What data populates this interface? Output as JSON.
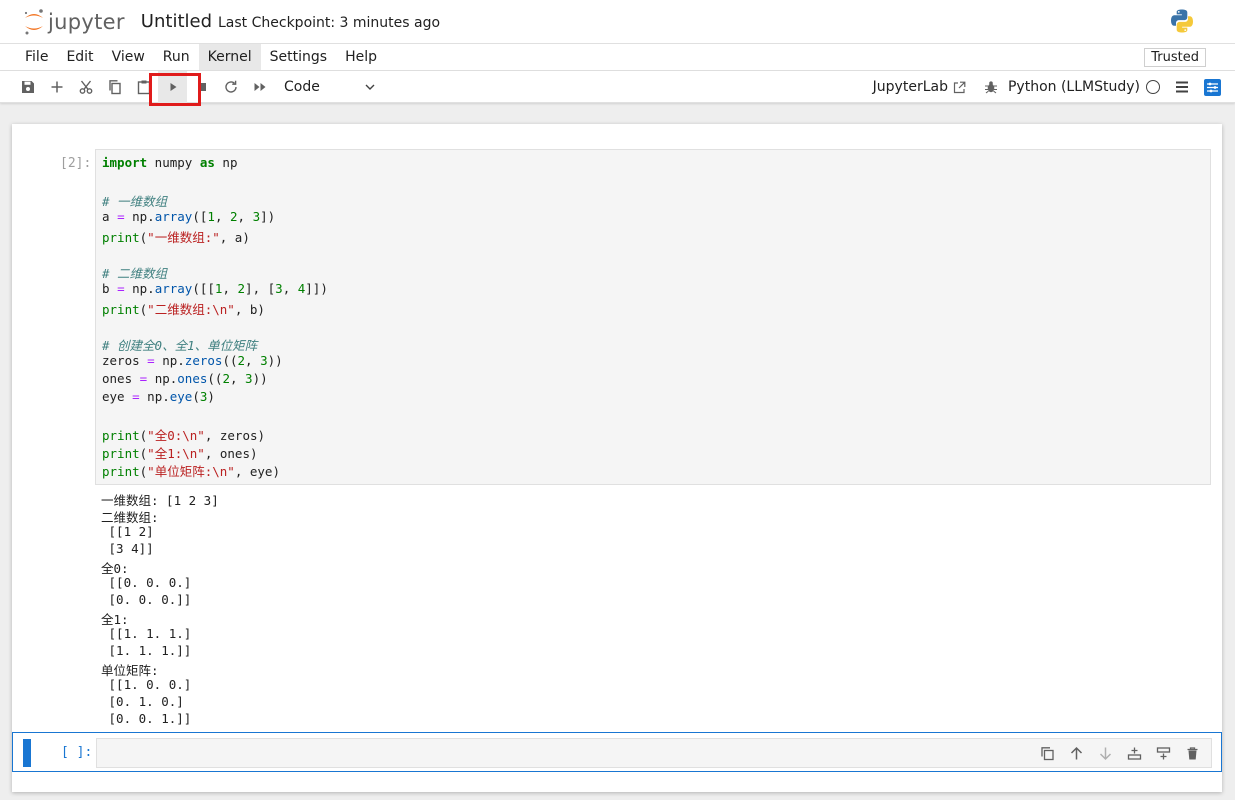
{
  "header": {
    "logo_text": "jupyter",
    "notebook_title": "Untitled",
    "checkpoint": "Last Checkpoint: 3 minutes ago"
  },
  "menu": {
    "items": [
      "File",
      "Edit",
      "View",
      "Run",
      "Kernel",
      "Settings",
      "Help"
    ],
    "active": "Kernel",
    "trusted": "Trusted"
  },
  "toolbar": {
    "cell_type": "Code",
    "jupyterlab_label": "JupyterLab",
    "kernel_name": "Python (LLMStudy)"
  },
  "cells": [
    {
      "prompt": "[2]:",
      "code": [
        "import numpy as np",
        "",
        "# 一维数组",
        "a = np.array([1, 2, 3])",
        "print(\"一维数组:\", a)",
        "",
        "# 二维数组",
        "b = np.array([[1, 2], [3, 4]])",
        "print(\"二维数组:\\n\", b)",
        "",
        "# 创建全0、全1、单位矩阵",
        "zeros = np.zeros((2, 3))",
        "ones = np.ones((2, 3))",
        "eye = np.eye(3)",
        "",
        "print(\"全0:\\n\", zeros)",
        "print(\"全1:\\n\", ones)",
        "print(\"单位矩阵:\\n\", eye)"
      ],
      "output": [
        "一维数组: [1 2 3]",
        "二维数组:",
        " [[1 2]",
        " [3 4]]",
        "全0:",
        " [[0. 0. 0.]",
        " [0. 0. 0.]]",
        "全1:",
        " [[1. 1. 1.]",
        " [1. 1. 1.]]",
        "单位矩阵:",
        " [[1. 0. 0.]",
        " [0. 1. 0.]",
        " [0. 0. 1.]]"
      ]
    },
    {
      "prompt": "[ ]:",
      "code": []
    }
  ],
  "colors": {
    "accent": "#1976d2",
    "highlight": "#e01b1b",
    "keyword": "#008000",
    "comment": "#408080",
    "string": "#ba2121"
  },
  "icons": {
    "toolbar": [
      "save-icon",
      "add-icon",
      "cut-icon",
      "copy-icon",
      "paste-icon",
      "run-icon",
      "stop-icon",
      "restart-icon",
      "fast-forward-icon"
    ],
    "cell_tools": [
      "duplicate-icon",
      "move-up-icon",
      "move-down-icon",
      "insert-above-icon",
      "insert-below-icon",
      "delete-icon"
    ]
  }
}
